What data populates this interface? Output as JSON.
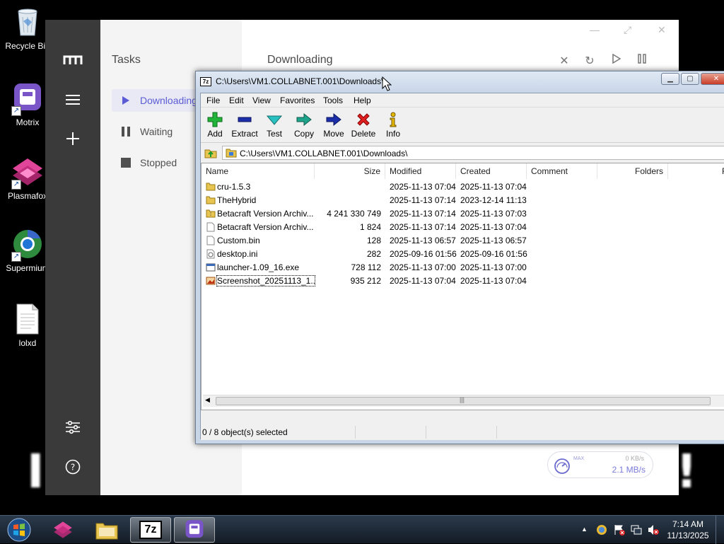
{
  "desktop": {
    "icons": [
      {
        "name": "recycle-bin",
        "label": "Recycle Bin"
      },
      {
        "name": "motrix",
        "label": "Motrix"
      },
      {
        "name": "plasmafox",
        "label": "Plasmafox"
      },
      {
        "name": "supermium",
        "label": "Supermium"
      },
      {
        "name": "lolxd",
        "label": "lolxd"
      }
    ]
  },
  "motrix": {
    "sidebar_title": "Tasks",
    "items": [
      {
        "label": "Downloading",
        "icon": "play-icon"
      },
      {
        "label": "Waiting",
        "icon": "pause-icon"
      },
      {
        "label": "Stopped",
        "icon": "stop-icon"
      }
    ],
    "main_title": "Downloading",
    "speed": {
      "max_label": "MAX",
      "upload": "0 KB/s",
      "download": "2.1 MB/s"
    }
  },
  "sevenzip": {
    "title": "C:\\Users\\VM1.COLLABNET.001\\Downloads\\",
    "menu": [
      "File",
      "Edit",
      "View",
      "Favorites",
      "Tools",
      "Help"
    ],
    "toolbar": [
      "Add",
      "Extract",
      "Test",
      "Copy",
      "Move",
      "Delete",
      "Info"
    ],
    "address": "C:\\Users\\VM1.COLLABNET.001\\Downloads\\",
    "columns": [
      "Name",
      "Size",
      "Modified",
      "Created",
      "Comment",
      "Folders",
      "Fi"
    ],
    "files": [
      {
        "name": "cru-1.5.3",
        "size": "",
        "modified": "2025-11-13 07:04",
        "created": "2025-11-13 07:04",
        "type": "folder"
      },
      {
        "name": "TheHybrid",
        "size": "",
        "modified": "2025-11-13 07:14",
        "created": "2023-12-14 11:13",
        "type": "folder"
      },
      {
        "name": "Betacraft Version Archiv...",
        "size": "4 241 330 749",
        "modified": "2025-11-13 07:14",
        "created": "2025-11-13 07:03",
        "type": "zip-folder"
      },
      {
        "name": "Betacraft Version Archiv...",
        "size": "1 824",
        "modified": "2025-11-13 07:14",
        "created": "2025-11-13 07:04",
        "type": "file"
      },
      {
        "name": "Custom.bin",
        "size": "128",
        "modified": "2025-11-13 06:57",
        "created": "2025-11-13 06:57",
        "type": "file"
      },
      {
        "name": "desktop.ini",
        "size": "282",
        "modified": "2025-09-16 01:56",
        "created": "2025-09-16 01:56",
        "type": "ini"
      },
      {
        "name": "launcher-1.09_16.exe",
        "size": "728 112",
        "modified": "2025-11-13 07:00",
        "created": "2025-11-13 07:00",
        "type": "exe"
      },
      {
        "name": "Screenshot_20251113_1...",
        "size": "935 212",
        "modified": "2025-11-13 07:04",
        "created": "2025-11-13 07:04",
        "type": "image"
      }
    ],
    "status": "0 / 8 object(s) selected"
  },
  "taskbar": {
    "apps": [
      "start",
      "plasmafox",
      "explorer",
      "7zip",
      "motrix"
    ],
    "clock": {
      "time": "7:14 AM",
      "date": "11/13/2025"
    }
  }
}
